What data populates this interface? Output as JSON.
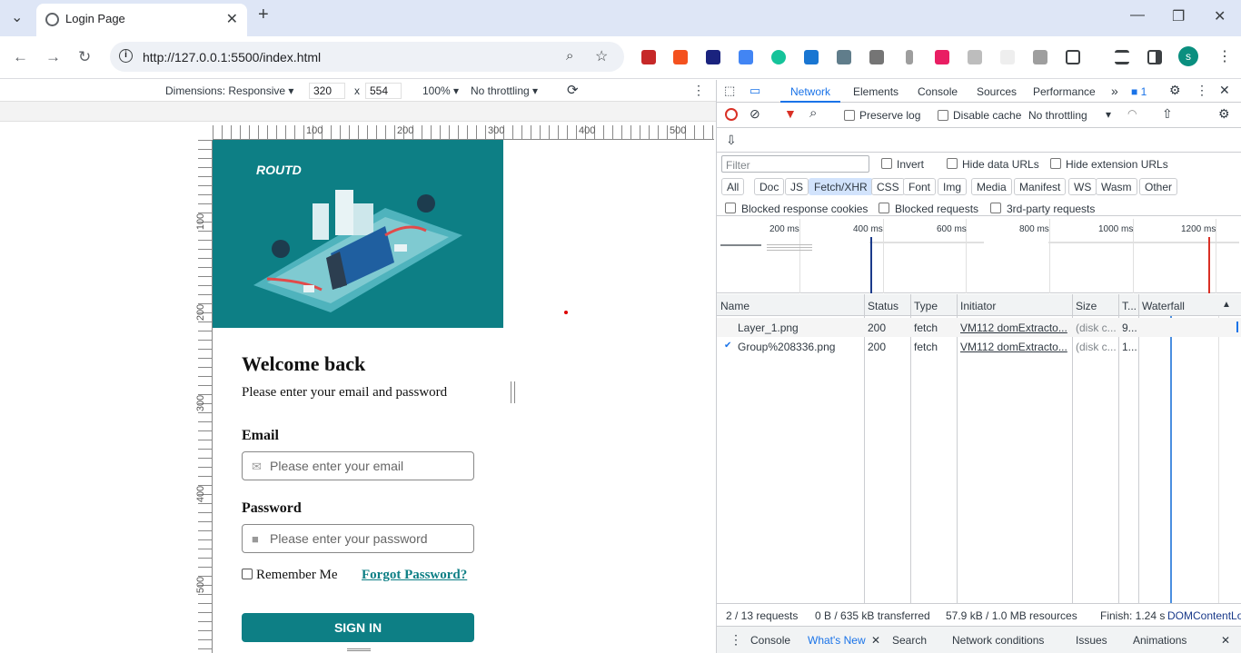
{
  "browser": {
    "tab_title": "Login Page",
    "url": "http://127.0.0.1:5500/index.html",
    "new_tab": "+",
    "close_tab": "✕",
    "win_min": "—",
    "win_max": "❐",
    "win_close": "✕",
    "profile_initial": "s"
  },
  "device_toolbar": {
    "dimensions": "Dimensions: Responsive ▾",
    "width": "320",
    "times": "x",
    "height": "554",
    "zoom": "100% ▾",
    "throttle": "No throttling ▾"
  },
  "rulers": {
    "h": [
      "100",
      "200",
      "300",
      "400",
      "500"
    ],
    "v": [
      "100",
      "200",
      "300",
      "400",
      "500"
    ]
  },
  "page": {
    "logo": "ROUTD",
    "welcome": "Welcome back",
    "subtitle": "Please enter your email and password",
    "email_label": "Email",
    "email_placeholder": "Please enter your email",
    "password_label": "Password",
    "password_placeholder": "Please enter your password",
    "remember": "Remember Me",
    "forgot": "Forgot Password?",
    "signin": "SIGN IN"
  },
  "devtools": {
    "tabs": [
      "Network",
      "Elements",
      "Console",
      "Sources",
      "Performance"
    ],
    "more": "»",
    "issues_count": "1",
    "preserve_log": "Preserve log",
    "disable_cache": "Disable cache",
    "throttle": "No throttling",
    "filter_placeholder": "Filter",
    "invert": "Invert",
    "hide_data": "Hide data URLs",
    "hide_ext": "Hide extension URLs",
    "filter_types": [
      "All",
      "Doc",
      "JS",
      "Fetch/XHR",
      "CSS",
      "Font",
      "Img",
      "Media",
      "Manifest",
      "WS",
      "Wasm",
      "Other"
    ],
    "blocked_cookies": "Blocked response cookies",
    "blocked_requests": "Blocked requests",
    "third_party": "3rd-party requests",
    "ticks": [
      "200 ms",
      "400 ms",
      "600 ms",
      "800 ms",
      "1000 ms",
      "1200 ms"
    ],
    "columns": [
      "Name",
      "Status",
      "Type",
      "Initiator",
      "Size",
      "T...",
      "Waterfall"
    ],
    "rows": [
      {
        "name": "Layer_1.png",
        "status": "200",
        "type": "fetch",
        "initiator": "VM112 domExtracto...",
        "size": "(disk c...",
        "time": "9..."
      },
      {
        "name": "Group%208336.png",
        "status": "200",
        "type": "fetch",
        "initiator": "VM112 domExtracto...",
        "size": "(disk c...",
        "time": "1..."
      }
    ],
    "summary": {
      "requests": "2 / 13 requests",
      "transferred": "0 B / 635 kB transferred",
      "resources": "57.9 kB / 1.0 MB resources",
      "finish": "Finish: 1.24 s",
      "dom": "DOMContentLo"
    },
    "drawer_tabs": [
      "Console",
      "What's New",
      "Search",
      "Network conditions",
      "Issues",
      "Animations"
    ]
  },
  "colors": {
    "brand": "#0d7f85",
    "accent": "#1a73e8"
  }
}
